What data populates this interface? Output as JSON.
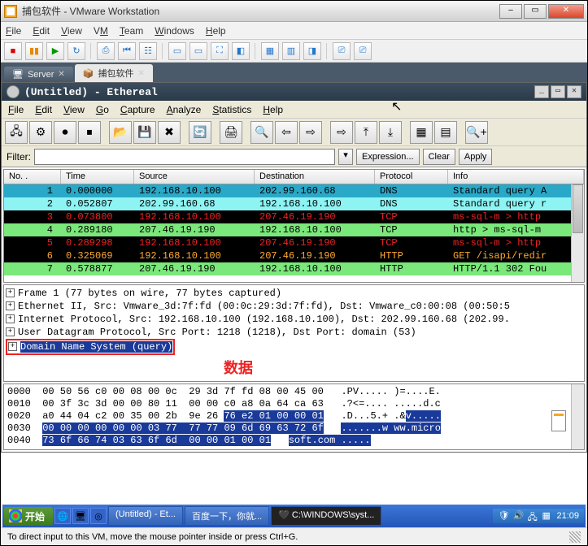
{
  "vmware": {
    "title": "捕包软件 - VMware Workstation",
    "menu": [
      "File",
      "Edit",
      "View",
      "VM",
      "Team",
      "Windows",
      "Help"
    ],
    "tabs": [
      {
        "icon": "server",
        "label": "Server"
      },
      {
        "icon": "box",
        "label": "捕包软件"
      }
    ]
  },
  "ethereal": {
    "title": "(Untitled) - Ethereal",
    "menu": [
      "File",
      "Edit",
      "View",
      "Go",
      "Capture",
      "Analyze",
      "Statistics",
      "Help"
    ],
    "filter_label": "Filter:",
    "filter_value": "",
    "btn_expression": "Expression...",
    "btn_clear": "Clear",
    "btn_apply": "Apply",
    "columns": [
      "No. .",
      "Time",
      "Source",
      "Destination",
      "Protocol",
      "Info"
    ],
    "packets": [
      {
        "no": "1",
        "time": "0.000000",
        "src": "192.168.10.100",
        "dst": "202.99.160.68",
        "proto": "DNS",
        "info": "Standard query A",
        "cls": "row-dns1"
      },
      {
        "no": "2",
        "time": "0.052807",
        "src": "202.99.160.68",
        "dst": "192.168.10.100",
        "proto": "DNS",
        "info": "Standard query r",
        "cls": "row-dns2"
      },
      {
        "no": "3",
        "time": "0.073800",
        "src": "192.168.10.100",
        "dst": "207.46.19.190",
        "proto": "TCP",
        "info": "ms-sql-m > http",
        "cls": "row-tcp"
      },
      {
        "no": "4",
        "time": "0.289180",
        "src": "207.46.19.190",
        "dst": "192.168.10.100",
        "proto": "TCP",
        "info": "http > ms-sql-m",
        "cls": "row-tcp-g"
      },
      {
        "no": "5",
        "time": "0.289298",
        "src": "192.168.10.100",
        "dst": "207.46.19.190",
        "proto": "TCP",
        "info": "ms-sql-m > http",
        "cls": "row-tcp"
      },
      {
        "no": "6",
        "time": "0.325069",
        "src": "192.168.10.100",
        "dst": "207.46.19.190",
        "proto": "HTTP",
        "info": "GET /isapi/redir",
        "cls": "row-http"
      },
      {
        "no": "7",
        "time": "0.578877",
        "src": "207.46.19.190",
        "dst": "192.168.10.100",
        "proto": "HTTP",
        "info": "HTTP/1.1 302 Fou",
        "cls": "row-http2"
      }
    ],
    "tree": [
      "Frame 1 (77 bytes on wire, 77 bytes captured)",
      "Ethernet II, Src: Vmware_3d:7f:fd (00:0c:29:3d:7f:fd), Dst: Vmware_c0:00:08 (00:50:5",
      "Internet Protocol, Src: 192.168.10.100 (192.168.10.100), Dst: 202.99.160.68 (202.99.",
      "User Datagram Protocol, Src Port: 1218 (1218), Dst Port: domain (53)",
      "Domain Name System (query)"
    ],
    "annotation": "数据",
    "hex": {
      "lines": [
        {
          "off": "0000",
          "hex": "00 50 56 c0 00 08 00 0c  29 3d 7f fd 08 00 45 00",
          "asc": ".PV..... )=....E."
        },
        {
          "off": "0010",
          "hex": "00 3f 3c 3d 00 00 80 11  00 00 c0 a8 0a 64 ca 63",
          "asc": ".?<=.... .....d.c"
        },
        {
          "off": "0020",
          "hex": "a0 44 04 c2 00 35 00 2b  9e 26 ",
          "sel_hex": "76 e2 01 00 00 01",
          "asc": ".D...5.+ .&",
          "sel_asc": "v....."
        },
        {
          "off": "0030",
          "sel_hex": "00 00 00 00 00 00 03 77  77 77 09 6d 69 63 72 6f",
          "sel_asc": ".......w ww.micro"
        },
        {
          "off": "0040",
          "sel_hex": "73 6f 66 74 03 63 6f 6d  00 00 01 00 01",
          "sel_asc": "soft.com ....."
        }
      ]
    }
  },
  "taskbar": {
    "start": "开始",
    "items": [
      {
        "label": "(Untitled) - Et..."
      },
      {
        "label": "百度一下，你就..."
      },
      {
        "label": "C:\\WINDOWS\\syst...",
        "cmd": true
      }
    ],
    "time": "21:09"
  },
  "statusbar": "To direct input to this VM, move the mouse pointer inside or press Ctrl+G."
}
